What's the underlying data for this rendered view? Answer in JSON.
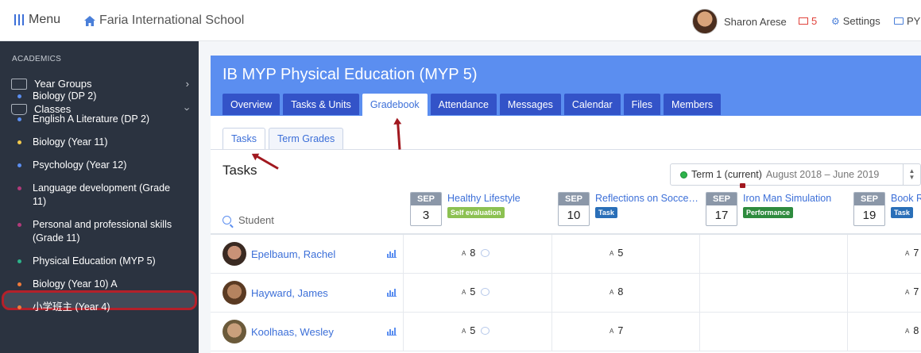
{
  "topbar": {
    "menu_label": "Menu",
    "school_name": "Faria International School",
    "user_name": "Sharon Arese",
    "mail_count": "5",
    "settings_label": "Settings",
    "pyp_label": "PYP"
  },
  "sidebar": {
    "section_heading": "ACADEMICS",
    "year_groups_label": "Year Groups",
    "classes_label": "Classes",
    "classes": [
      {
        "label": "Biology (DP 2)",
        "dot_color": "#5b8ef0"
      },
      {
        "label": "English A Literature (DP 2)",
        "dot_color": "#5b8ef0"
      },
      {
        "label": "Biology (Year 11)",
        "dot_color": "#f2c94c"
      },
      {
        "label": "Psychology (Year 12)",
        "dot_color": "#5b8ef0"
      },
      {
        "label": "Language development (Grade 11)",
        "dot_color": "#b03a7a"
      },
      {
        "label": "Personal and professional skills (Grade 11)",
        "dot_color": "#b03a7a"
      },
      {
        "label": "Physical Education (MYP 5)",
        "dot_color": "#2db38a"
      },
      {
        "label": "Biology (Year 10) A",
        "dot_color": "#f07a3a"
      },
      {
        "label": "小学班主 (Year 4)",
        "dot_color": "#f07a3a"
      }
    ]
  },
  "class_page": {
    "title": "IB MYP Physical Education (MYP 5)",
    "tabs": [
      "Overview",
      "Tasks & Units",
      "Gradebook",
      "Attendance",
      "Messages",
      "Calendar",
      "Files",
      "Members"
    ],
    "active_tab": "Gradebook",
    "subtabs": [
      "Tasks",
      "Term Grades"
    ],
    "section_title": "Tasks",
    "term_select": {
      "term": "Term 1 (current)",
      "range": "August 2018 – June 2019"
    },
    "search_placeholder": "Student"
  },
  "tasks": [
    {
      "month": "SEP",
      "day": "3",
      "title": "Healthy Lifestyle",
      "type": "Self evaluation",
      "type_color": "#8cc152"
    },
    {
      "month": "SEP",
      "day": "10",
      "title": "Reflections on Socce…",
      "type": "Task",
      "type_color": "#2a6fb8"
    },
    {
      "month": "SEP",
      "day": "17",
      "title": "Iron Man Simulation",
      "type": "Performance",
      "type_color": "#2e8b3e"
    },
    {
      "month": "SEP",
      "day": "19",
      "title": "Book R",
      "type": "Task",
      "type_color": "#2a6fb8"
    }
  ],
  "students": [
    {
      "name": "Epelbaum, Rachel",
      "grades": [
        {
          "crit": "A",
          "val": "8",
          "comment": true
        },
        {
          "crit": "A",
          "val": "5",
          "comment": false
        },
        null,
        {
          "crit": "A",
          "val": "7",
          "comment": false
        }
      ]
    },
    {
      "name": "Hayward, James",
      "grades": [
        {
          "crit": "A",
          "val": "5",
          "comment": true
        },
        {
          "crit": "A",
          "val": "8",
          "comment": false
        },
        null,
        {
          "crit": "A",
          "val": "7",
          "comment": false
        }
      ]
    },
    {
      "name": "Koolhaas, Wesley",
      "grades": [
        {
          "crit": "A",
          "val": "5",
          "comment": true
        },
        {
          "crit": "A",
          "val": "7",
          "comment": false
        },
        null,
        {
          "crit": "A",
          "val": "8",
          "comment": false
        }
      ]
    }
  ]
}
